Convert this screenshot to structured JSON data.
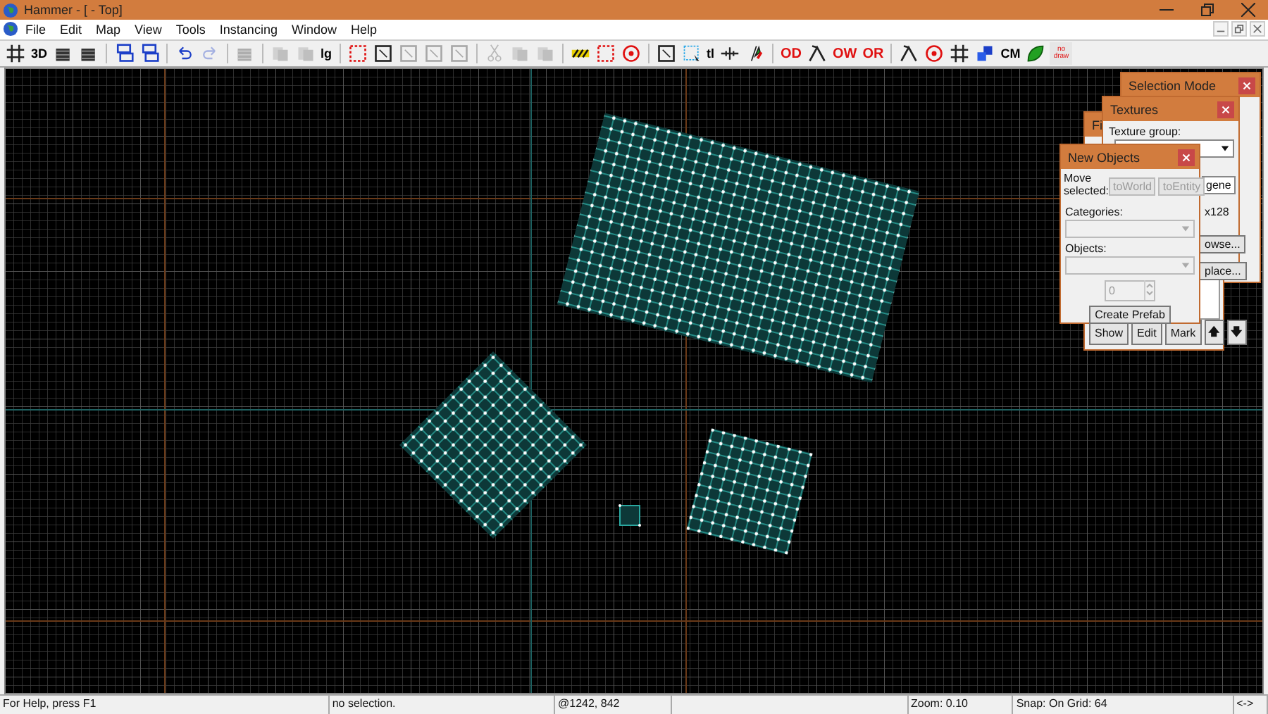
{
  "window": {
    "title": "Hammer - [ - Top]"
  },
  "menu": [
    {
      "label": "File"
    },
    {
      "label": "Edit"
    },
    {
      "label": "Map"
    },
    {
      "label": "View"
    },
    {
      "label": "Tools"
    },
    {
      "label": "Instancing"
    },
    {
      "label": "Window"
    },
    {
      "label": "Help"
    }
  ],
  "toolbar": [
    {
      "kind": "grid",
      "disabled": false
    },
    {
      "kind": "text",
      "label": "3D",
      "disabled": false
    },
    {
      "kind": "box",
      "disabled": false
    },
    {
      "kind": "box",
      "disabled": false
    },
    {
      "kind": "sep"
    },
    {
      "kind": "group",
      "disabled": false
    },
    {
      "kind": "group",
      "disabled": false
    },
    {
      "kind": "sep"
    },
    {
      "kind": "undo",
      "disabled": false
    },
    {
      "kind": "redo",
      "disabled": true
    },
    {
      "kind": "sep"
    },
    {
      "kind": "box",
      "disabled": true
    },
    {
      "kind": "sep"
    },
    {
      "kind": "pages",
      "disabled": true
    },
    {
      "kind": "pages",
      "disabled": true
    },
    {
      "kind": "text",
      "label": "lg",
      "disabled": false
    },
    {
      "kind": "sep"
    },
    {
      "kind": "dashed",
      "disabled": false
    },
    {
      "kind": "frame",
      "disabled": false
    },
    {
      "kind": "frame",
      "disabled": true
    },
    {
      "kind": "frame",
      "disabled": true
    },
    {
      "kind": "frame",
      "disabled": true
    },
    {
      "kind": "sep"
    },
    {
      "kind": "cut",
      "disabled": true
    },
    {
      "kind": "pages",
      "disabled": true
    },
    {
      "kind": "pages",
      "disabled": true
    },
    {
      "kind": "sep"
    },
    {
      "kind": "hatch",
      "disabled": false
    },
    {
      "kind": "dashed",
      "disabled": false
    },
    {
      "kind": "ring",
      "disabled": false
    },
    {
      "kind": "sep"
    },
    {
      "kind": "frame",
      "disabled": false
    },
    {
      "kind": "select",
      "disabled": false
    },
    {
      "kind": "text",
      "label": "tl",
      "disabled": false
    },
    {
      "kind": "split",
      "disabled": false
    },
    {
      "kind": "flag",
      "disabled": false
    },
    {
      "kind": "sep"
    },
    {
      "kind": "letters",
      "label": "OD",
      "disabled": false
    },
    {
      "kind": "pick",
      "disabled": false
    },
    {
      "kind": "letters",
      "label": "OW",
      "disabled": false
    },
    {
      "kind": "letters",
      "label": "OR",
      "disabled": false
    },
    {
      "kind": "sep"
    },
    {
      "kind": "pick",
      "disabled": false
    },
    {
      "kind": "ring",
      "disabled": false
    },
    {
      "kind": "grid",
      "disabled": false
    },
    {
      "kind": "cubes",
      "disabled": false
    },
    {
      "kind": "text",
      "label": "CM",
      "disabled": false
    },
    {
      "kind": "leaf",
      "disabled": false
    },
    {
      "kind": "tiny",
      "label": "no draw",
      "disabled": false
    }
  ],
  "panels": [
    {
      "kind": "selection",
      "title": "Selection Mode"
    },
    {
      "kind": "filter",
      "title": "Fi",
      "buttons": [
        "Show",
        "Edit",
        "Mark",
        "🡅",
        "🡇"
      ]
    },
    {
      "kind": "textures",
      "title": "Textures",
      "group_label": "Texture group:",
      "filter_value": "gene",
      "size": "x128",
      "buttons": [
        "owse...",
        "place..."
      ]
    },
    {
      "kind": "objects",
      "title": "New Objects",
      "move_label": "Move selected:",
      "move_buttons": [
        "toWorld",
        "toEntity"
      ],
      "categories_label": "Categories:",
      "objects_label": "Objects:",
      "count": "0",
      "create_button": "Create Prefab"
    }
  ],
  "status_bar": [
    "For Help, press F1",
    "no selection.",
    "@1242, 842",
    "Zoom: 0.10",
    "Snap: On Grid: 64",
    "<->"
  ]
}
